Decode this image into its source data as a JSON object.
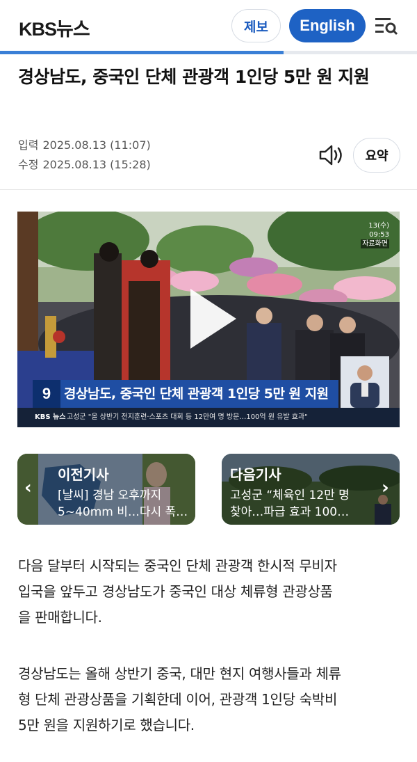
{
  "header": {
    "logo_main": "KBS",
    "logo_sub": "뉴스",
    "tip_button": "제보",
    "english_button": "English",
    "menu_icon": "menu-search-icon",
    "reading_progress": 0.68
  },
  "article": {
    "title": "경상남도, 중국인 단체 관광객 1인당 5만 원 지원",
    "published_label": "입력",
    "published": "2025.08.13 (11:07)",
    "modified_label": "수정",
    "modified": "2025.08.13 (15:28)",
    "speaker_icon": "speaker-icon",
    "summary_button": "요약"
  },
  "video": {
    "watermark_time": "13(수) 09:53",
    "watermark_tag": "자료화면",
    "caption_logo": "9",
    "caption": "경상남도, 중국인 단체 관광객 1인당 5만 원 지원",
    "ticker_logo": "KBS 뉴스",
    "ticker": "고성군 \"올 상반기 전지훈련·스포츠 대회 등 12만여 명 방문…100억 원 유발 효과\"",
    "play_icon": "play-icon"
  },
  "nav_cards": {
    "prev": {
      "label": "이전기사",
      "desc_line1": "[날씨] 경남 오후까지",
      "desc_line2": "5~40mm 비…다시 폭…"
    },
    "next": {
      "label": "다음기사",
      "desc_line1": "고성군 “체육인 12만 명",
      "desc_line2": "찾아…파급 효과 100…"
    }
  },
  "body": {
    "p1_l1": "다음 달부터 시작되는 중국인 단체 관광객 한시적 무비자",
    "p1_l2": "입국을 앞두고 경상남도가 중국인 대상 체류형 관광상품",
    "p1_l3": "을 판매합니다.",
    "p2_l1": "경상남도는 올해 상반기 중국, 대만 현지 여행사들과 체류",
    "p2_l2": "형 단체 관광상품을 기획한데 이어, 관광객 1인당 숙박비",
    "p2_l3": "5만 원을 지원하기로 했습니다."
  },
  "colors": {
    "brand_blue": "#1e62c4",
    "progress": "#3a7fd6",
    "caption_bar": "#1f4ea3"
  }
}
